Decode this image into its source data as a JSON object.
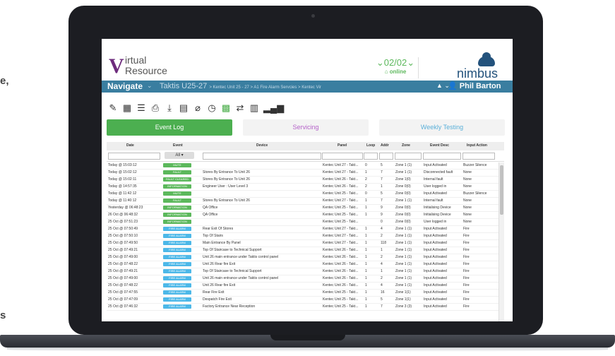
{
  "side_fragments": [
    "e,",
    "s"
  ],
  "app": {
    "logo": {
      "initial": "V",
      "line1": "irtual",
      "line2": "Resource"
    },
    "status": {
      "count": "02/02",
      "online": "online"
    },
    "brand": "nimbus",
    "nav": {
      "label": "Navigate",
      "site": "Taktis U25-27",
      "breadcrumb": "> Kentec Unit 25 - 27 > A1 Fire Alarm Servcies > Kentec Vir",
      "user": "Phil Barton"
    },
    "tabs": [
      "Event Log",
      "Servicing",
      "Weekly Testing"
    ],
    "columns": [
      "Date",
      "Event",
      "Device",
      "Panel",
      "Loop",
      "Addr",
      "Zone",
      "Event Desc",
      "Input Action"
    ],
    "filter_all": "All",
    "colors": {
      "mute": "#5cb85c",
      "fault": "#5cb85c",
      "fault_cleared": "#5cb85c",
      "information": "#5cb85c",
      "fire_alarm": "#4db8e8"
    },
    "rows": [
      {
        "date": "Today @ 15:03:12",
        "event": "MUTE",
        "type": "mute",
        "device": "",
        "panel": "Kentec Unit 27 - Takt...",
        "loop": "0",
        "addr": "5",
        "zone": "Zone 1 (1)",
        "desc": "Input Activated",
        "action": "Buzzer Silence"
      },
      {
        "date": "Today @ 15:02:12",
        "event": "FAULT",
        "type": "fault",
        "device": "Stores By Entrance To Unit 26",
        "panel": "Kentec Unit 27 - Takt...",
        "loop": "1",
        "addr": "7",
        "zone": "Zone 1 (1)",
        "desc": "Disconnected fault",
        "action": "None"
      },
      {
        "date": "Today @ 15:02:11",
        "event": "FAULT CLEARED",
        "type": "fault_cleared",
        "device": "Stores By Entrance To Unit 26",
        "panel": "Kentec Unit 26 - Takt...",
        "loop": "2",
        "addr": "7",
        "zone": "Zone 1(0)",
        "desc": "Internal fault",
        "action": "None"
      },
      {
        "date": "Today @ 14:57:35",
        "event": "INFORMATION",
        "type": "information",
        "device": "Engineer User : User Level 3",
        "panel": "Kentec Unit 26 - Takt...",
        "loop": "2",
        "addr": "1",
        "zone": "Zone 0(0)",
        "desc": "User logged in",
        "action": "None"
      },
      {
        "date": "Today @ 11:42:12",
        "event": "MUTE",
        "type": "mute",
        "device": "",
        "panel": "Kentec Unit 25 - Takt...",
        "loop": "0",
        "addr": "5",
        "zone": "Zone 0(0)",
        "desc": "Input Activated",
        "action": "Buzzer Silence"
      },
      {
        "date": "Today @ 11:40:12",
        "event": "FAULT",
        "type": "fault",
        "device": "Stores By Entrance To Unit 26",
        "panel": "Kentec Unit 27 - Takt...",
        "loop": "1",
        "addr": "7",
        "zone": "Zone 1 (1)",
        "desc": "Internal fault",
        "action": "None"
      },
      {
        "date": "Yesterday @ 06:48:23",
        "event": "INFORMATION",
        "type": "information",
        "device": "QA Office",
        "panel": "Kentec Unit 25 - Takt...",
        "loop": "1",
        "addr": "9",
        "zone": "Zone 0(0)",
        "desc": "Initialising Device",
        "action": "None"
      },
      {
        "date": "26 Oct @ 06:48:32",
        "event": "INFORMATION",
        "type": "information",
        "device": "QA Office",
        "panel": "Kentec Unit 25 - Takt...",
        "loop": "1",
        "addr": "9",
        "zone": "Zone 0(0)",
        "desc": "Initialising Device",
        "action": "None"
      },
      {
        "date": "25 Oct @ 07:51:23",
        "event": "INFORMATION",
        "type": "information",
        "device": "",
        "panel": "Kentec Unit 25 - Takt...",
        "loop": "",
        "addr": "0",
        "zone": "Zone 0(0)",
        "desc": "User logged in",
        "action": "None"
      },
      {
        "date": "25 Oct @ 07:50:49",
        "event": "FIRE ALARM",
        "type": "fire_alarm",
        "device": "Rear Exit Of Stores",
        "panel": "Kentec Unit 27 - Takt...",
        "loop": "1",
        "addr": "4",
        "zone": "Zone 1 (1)",
        "desc": "Input Activated",
        "action": "Fire"
      },
      {
        "date": "25 Oct @ 07:50:10",
        "event": "FIRE ALARM",
        "type": "fire_alarm",
        "device": "Top Of Stairs",
        "panel": "Kentec Unit 27 - Takt...",
        "loop": "1",
        "addr": "2",
        "zone": "Zone 1 (1)",
        "desc": "Input Activated",
        "action": "Fire"
      },
      {
        "date": "25 Oct @ 07:49:50",
        "event": "FIRE ALARM",
        "type": "fire_alarm",
        "device": "Main Entrance By Panel",
        "panel": "Kentec Unit 27 - Takt...",
        "loop": "1",
        "addr": "118",
        "zone": "Zone 1 (1)",
        "desc": "Input Activated",
        "action": "Fire"
      },
      {
        "date": "25 Oct @ 07:49:21",
        "event": "FIRE ALARM",
        "type": "fire_alarm",
        "device": "Top Of Staircase to Technical Support",
        "panel": "Kentec Unit 26 - Takt...",
        "loop": "1",
        "addr": "1",
        "zone": "Zone 1 (1)",
        "desc": "Input Activated",
        "action": "Fire"
      },
      {
        "date": "25 Oct @ 07:49:00",
        "event": "FIRE ALARM",
        "type": "fire_alarm",
        "device": "Unit 26 main entrance under Taktis control panel",
        "panel": "Kentec Unit 26 - Takt...",
        "loop": "1",
        "addr": "2",
        "zone": "Zone 1 (1)",
        "desc": "Input Activated",
        "action": "Fire"
      },
      {
        "date": "25 Oct @ 07:48:22",
        "event": "FIRE ALARM",
        "type": "fire_alarm",
        "device": "Unit 26 Rear fire Exit",
        "panel": "Kentec Unit 26 - Takt...",
        "loop": "1",
        "addr": "4",
        "zone": "Zone 1 (1)",
        "desc": "Input Activated",
        "action": "Fire"
      },
      {
        "date": "25 Oct @ 07:49:21",
        "event": "FIRE ALARM",
        "type": "fire_alarm",
        "device": "Top Of Staircase to Technical Support",
        "panel": "Kentec Unit 26 - Takt...",
        "loop": "1",
        "addr": "1",
        "zone": "Zone 1 (1)",
        "desc": "Input Activated",
        "action": "Fire"
      },
      {
        "date": "25 Oct @ 07:49:00",
        "event": "FIRE ALARM",
        "type": "fire_alarm",
        "device": "Unit 26 main entrance under Taktis control panel",
        "panel": "Kentec Unit 26 - Takt...",
        "loop": "1",
        "addr": "2",
        "zone": "Zone 1 (1)",
        "desc": "Input Activated",
        "action": "Fire"
      },
      {
        "date": "25 Oct @ 07:48:22",
        "event": "FIRE ALARM",
        "type": "fire_alarm",
        "device": "Unit 26 Rear fire Exit",
        "panel": "Kentec Unit 26 - Takt...",
        "loop": "1",
        "addr": "4",
        "zone": "Zone 1 (1)",
        "desc": "Input Activated",
        "action": "Fire"
      },
      {
        "date": "25 Oct @ 07:47:55",
        "event": "FIRE ALARM",
        "type": "fire_alarm",
        "device": "Rear Fire Exit",
        "panel": "Kentec Unit 25 - Takt...",
        "loop": "1",
        "addr": "16",
        "zone": "Zone 1(1)",
        "desc": "Input Activated",
        "action": "Fire"
      },
      {
        "date": "25 Oct @ 07:47:09",
        "event": "FIRE ALARM",
        "type": "fire_alarm",
        "device": "Despatch Fire Exit",
        "panel": "Kentec Unit 25 - Takt...",
        "loop": "1",
        "addr": "5",
        "zone": "Zone 1(1)",
        "desc": "Input Activated",
        "action": "Fire"
      },
      {
        "date": "25 Oct @ 07:46:32",
        "event": "FIRE ALARM",
        "type": "fire_alarm",
        "device": "Factory Entrance Near Reception",
        "panel": "Kentec Unit 25 - Takt...",
        "loop": "1",
        "addr": "7",
        "zone": "Zone 3 (3)",
        "desc": "Input Activated",
        "action": "Fire"
      }
    ]
  }
}
